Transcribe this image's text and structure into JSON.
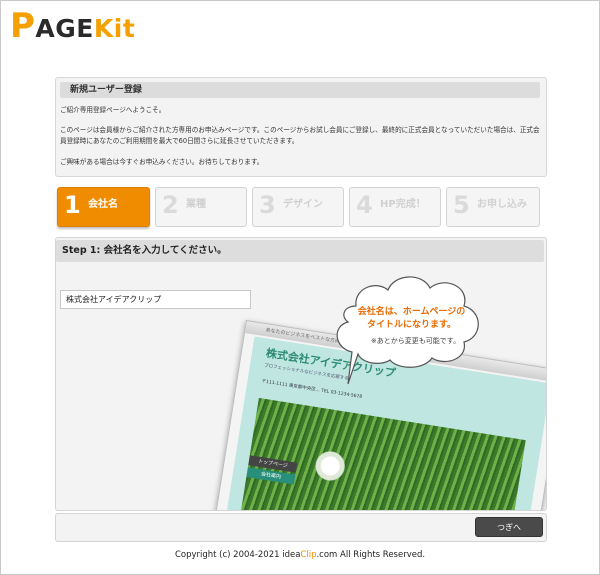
{
  "logo": {
    "p": "P",
    "age": "AGE",
    "k": "K",
    "it": "it"
  },
  "intro": {
    "title": "新規ユーザー登録",
    "lines": [
      "ご紹介専用登録ページへようこそ。",
      "このページは会員様からご紹介された方専用のお申込みページです。このページからお試し会員にご登録し、最終的に正式会員となっていただいた場合は、正式会員登録時にあなたのご利用期間を最大で60日間さらに延長させていただきます。",
      "ご興味がある場合は今すぐお申込みください。お待ちしております。"
    ]
  },
  "steps": [
    {
      "num": "1",
      "label": "会社名",
      "active": true
    },
    {
      "num": "2",
      "label": "業種",
      "active": false
    },
    {
      "num": "3",
      "label": "デザイン",
      "active": false
    },
    {
      "num": "4",
      "label": "HP完成！",
      "active": false
    },
    {
      "num": "5",
      "label": "お申し込み",
      "active": false
    }
  ],
  "panel": {
    "heading": "Step 1: 会社名を入力してください。",
    "company_value": "株式会社アイデアクリップ",
    "bubble_line1": "会社名は、ホームページの",
    "bubble_line2": "タイトルになります。",
    "bubble_note": "※あとから変更も可能です。",
    "preview_title": "株式会社アイデアクリップ",
    "preview_sub": "プロフェッショナルなビジネスを応援する",
    "preview_addr": "〒111-1111 東京都中央区... TEL 03-1234-5678",
    "preview_bar": "あなたのビジネスをベストな方向へ",
    "preview_nav1": "トップページ",
    "preview_nav2": "会社案内"
  },
  "bottom": {
    "next_label": "つぎへ"
  },
  "footer": {
    "prefix": "Copyright (c) 2004-2021 idea",
    "accent": "Clip",
    "suffix": ".com All Rights Reserved."
  }
}
